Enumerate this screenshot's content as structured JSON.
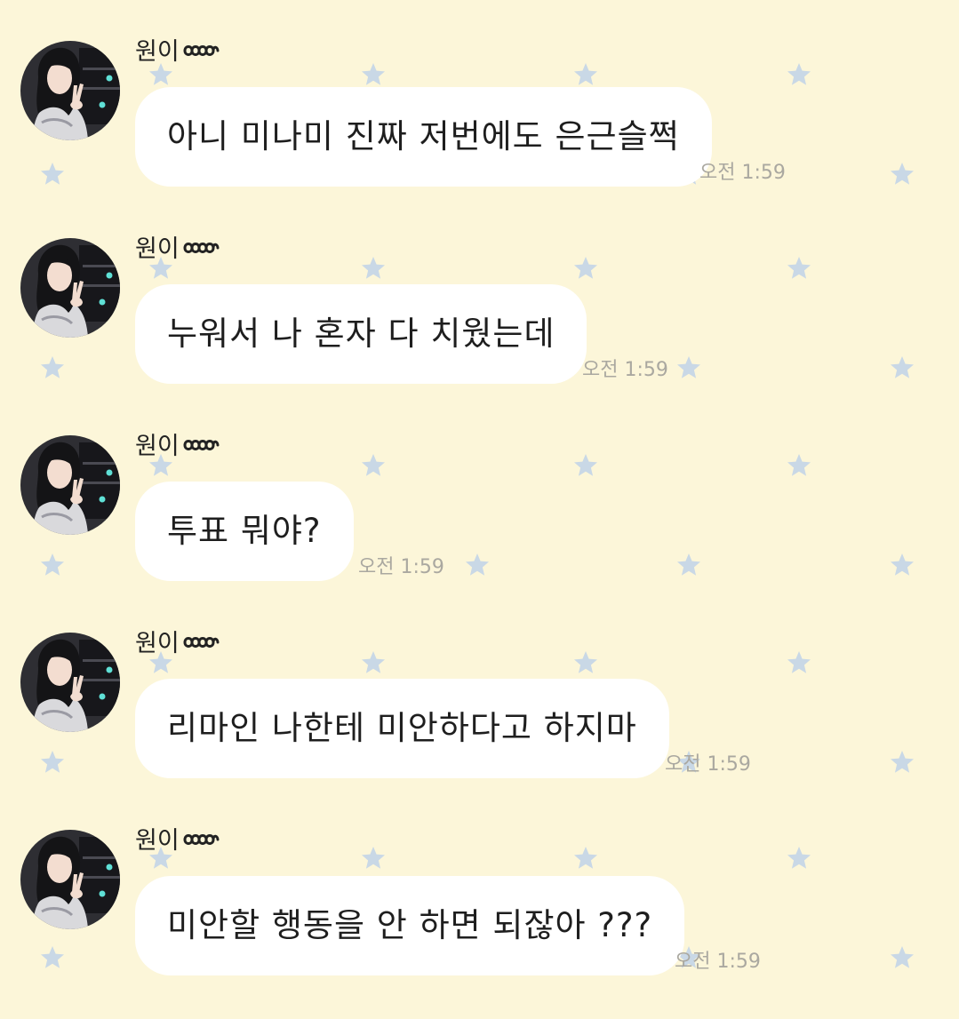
{
  "chat": {
    "messages": [
      {
        "sender": "원이",
        "text": "아니 미나미 진짜 저번에도 은근슬쩍",
        "time": "오전 1:59"
      },
      {
        "sender": "원이",
        "text": "누워서 나 혼자 다 치웠는데",
        "time": "오전 1:59"
      },
      {
        "sender": "원이",
        "text": "투표 뭐야?",
        "time": "오전 1:59"
      },
      {
        "sender": "원이",
        "text": "리마인 나한테 미안하다고 하지마",
        "time": "오전 1:59"
      },
      {
        "sender": "원이",
        "text": "미안할 행동을 안 하면 되잖아 ???",
        "time": "오전 1:59"
      }
    ]
  },
  "theme": {
    "background": "#fcf6d9",
    "bubble": "#ffffff",
    "star": "#c9d8e6",
    "sender_decoration": "ribbon-loops-icon",
    "avatar": "profile-photo-avatar"
  }
}
